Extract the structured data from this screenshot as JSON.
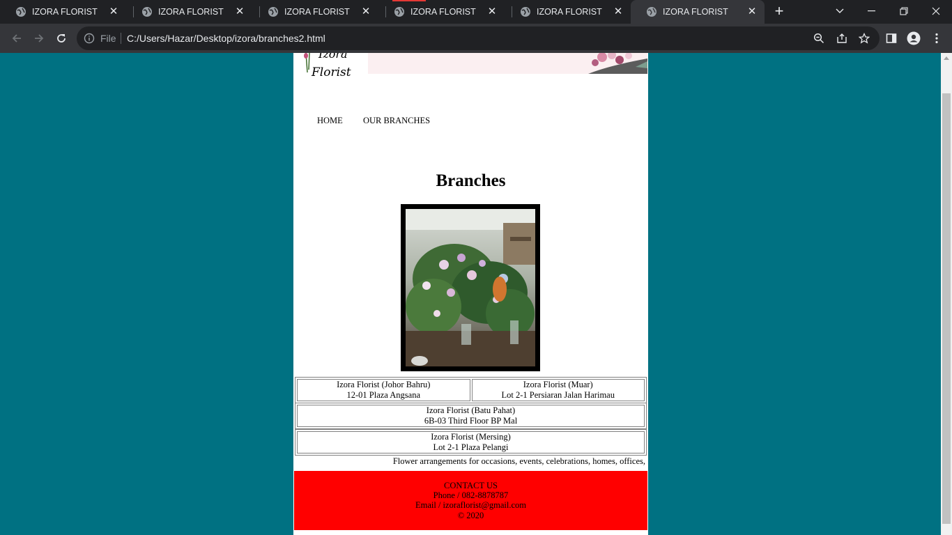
{
  "browser": {
    "tabs": [
      {
        "title": "IZORA FLORIST"
      },
      {
        "title": "IZORA FLORIST"
      },
      {
        "title": "IZORA FLORIST"
      },
      {
        "title": "IZORA FLORIST"
      },
      {
        "title": "IZORA FLORIST"
      },
      {
        "title": "IZORA FLORIST",
        "active": true
      }
    ],
    "address": {
      "scheme_label": "File",
      "url": "C:/Users/Hazar/Desktop/izora/branches2.html"
    },
    "icons": {
      "back": "arrow-left-icon",
      "forward": "arrow-right-icon",
      "reload": "reload-icon",
      "zoom": "zoom-icon",
      "share": "share-icon",
      "bookmark": "star-icon",
      "sidepanel": "side-panel-icon",
      "profile": "profile-icon",
      "menu": "kebab-menu-icon"
    }
  },
  "page": {
    "logo_text": "Florist",
    "nav": {
      "home": "HOME",
      "branches": "OUR BRANCHES"
    },
    "title": "Branches",
    "branches": [
      {
        "name": "Izora Florist (Johor Bahru)",
        "address": "12-01 Plaza Angsana"
      },
      {
        "name": "Izora Florist (Muar)",
        "address": "Lot 2-1 Persiaran Jalan Harimau"
      },
      {
        "name": "Izora Florist (Batu Pahat)",
        "address": "6B-03 Third Floor BP Mal"
      },
      {
        "name": "Izora Florist (Mersing)",
        "address": "Lot 2-1 Plaza Pelangi"
      }
    ],
    "tagline": "Flower arrangements for occasions, events, celebrations, homes, offices,",
    "footer": {
      "heading": "CONTACT US",
      "phone": "Phone / 082-8878787",
      "email": "Email / izoraflorist@gmail.com",
      "copyright": "© 2020"
    }
  },
  "colors": {
    "page_background": "#007182",
    "footer": "#ff0000",
    "banner": "#fbeff1"
  }
}
